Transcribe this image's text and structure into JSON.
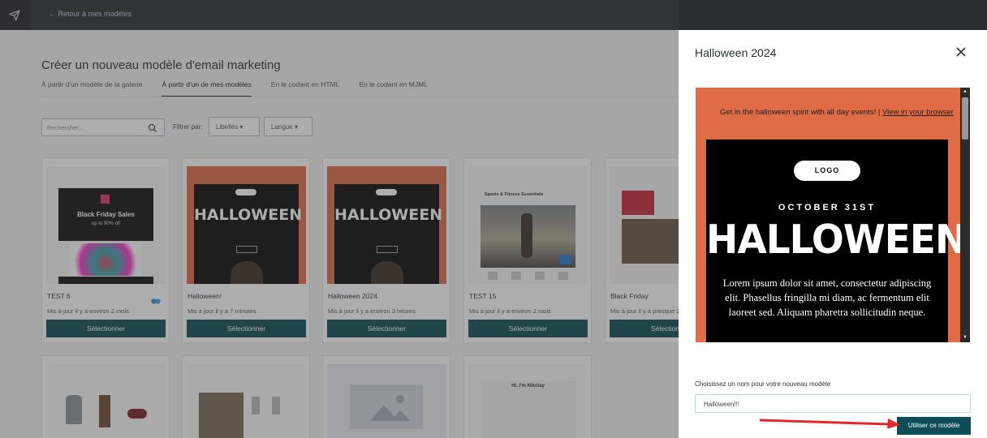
{
  "header": {
    "back_link": "← Retour à mes modèles"
  },
  "main": {
    "title": "Créer un nouveau modèle d'email marketing",
    "tabs": [
      {
        "label": "À partir d'un modèle de la galerie",
        "active": false
      },
      {
        "label": "À partir d'un de mes modèles",
        "active": true
      },
      {
        "label": "En le codant en HTML",
        "active": false
      },
      {
        "label": "En le codant en MJML",
        "active": false
      }
    ],
    "search_placeholder": "Rechercher...",
    "filter_label": "Filtrer par:",
    "filter_tags": "Libellés",
    "filter_lang": "Langue",
    "cards": [
      {
        "name": "TEST 6",
        "updated": "Mis à jour il y a environ 2 mois",
        "select": "Sélectionner",
        "thumb_text": "Black Friday Sales",
        "thumb_sub": "up to 90% off"
      },
      {
        "name": "Halloween!",
        "updated": "Mis à jour il y a 7 minutes",
        "select": "Sélectionner",
        "thumb_text": "HALLOWEEN"
      },
      {
        "name": "Halloween 2024",
        "updated": "Mis à jour il y a environ 3 heures",
        "select": "Sélectionner",
        "thumb_text": "HALLOWEEN"
      },
      {
        "name": "TEST 15",
        "updated": "Mis à jour il y a environ 2 mois",
        "select": "Sélectionner",
        "thumb_text": "Sports & Fitness Essentials"
      },
      {
        "name": "Black Friday",
        "updated": "Mis à jour il y a presque 2",
        "select": "Sélection"
      }
    ],
    "row2_thumb_text": "Hi, I'm Nikolay"
  },
  "panel": {
    "title": "Halloween 2024",
    "preview_top": "Get in the halloween spirit with all day events!",
    "preview_link": "View in your browser",
    "preview_logo": "LOGO",
    "preview_date": "OCTOBER 31ST",
    "preview_heading": "HALLOWEEN",
    "preview_body": "Lorem ipsum dolor sit amet, consectetur adipiscing elit. Phasellus fringilla mi diam, ac fermentum elit laoreet sed. Aliquam pharetra sollicitudin neque.",
    "name_label": "Choisissez un nom pour votre nouveau modèle",
    "name_value": "Halloween!!!",
    "use_button": "Utiliser ce modèle"
  },
  "colors": {
    "accent": "#0e4c57",
    "halloween_orange": "#e06c45",
    "arrow": "#e5262a"
  }
}
